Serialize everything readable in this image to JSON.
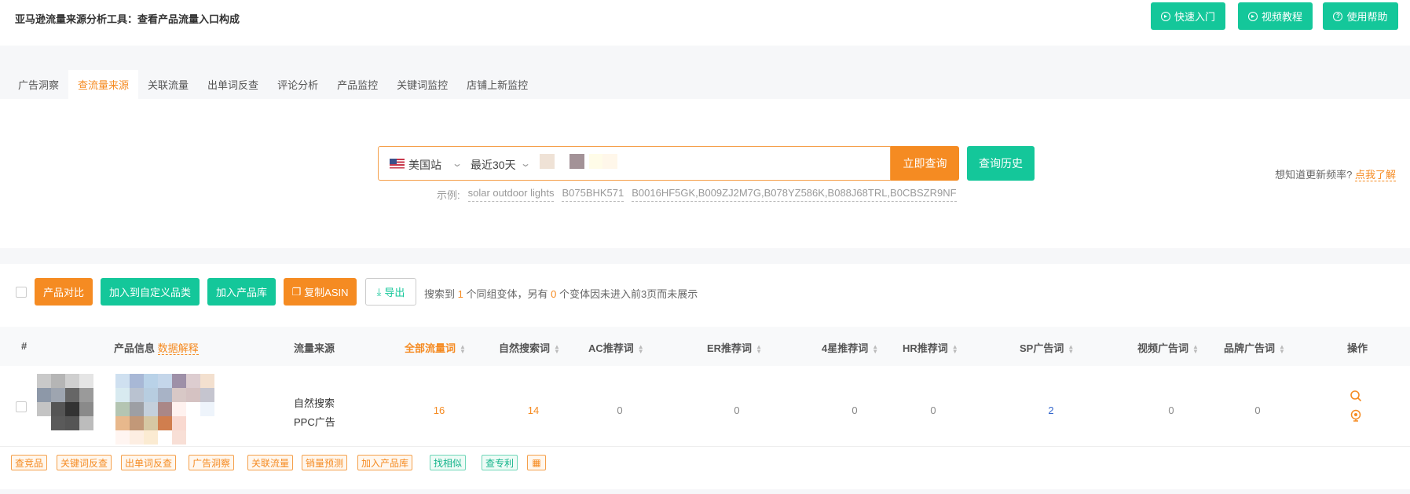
{
  "header": {
    "title": "亚马逊流量来源分析工具：查看产品流量入口构成",
    "buttons": [
      "快速入门",
      "视频教程",
      "使用帮助"
    ]
  },
  "tabs": [
    "广告洞察",
    "查流量来源",
    "关联流量",
    "出单词反查",
    "评论分析",
    "产品监控",
    "关键词监控",
    "店铺上新监控"
  ],
  "active_tab": "查流量来源",
  "search": {
    "site": "美国站",
    "period": "最近30天",
    "query_button": "立即查询",
    "history_button": "查询历史",
    "examples_label": "示例:",
    "examples": [
      "solar outdoor lights",
      "B075BHK571",
      "B0016HF5GK,B009ZJ2M7G,B078YZ586K,B088J68TRL,B0CBSZR9NF"
    ],
    "update_hint": "想知道更新频率?",
    "update_link": "点我了解"
  },
  "toolbar": {
    "buttons": [
      "产品对比",
      "加入到自定义品类",
      "加入产品库",
      "复制ASIN",
      "导出"
    ],
    "summary_pre": "搜索到",
    "summary_count1": "1",
    "summary_mid": "个同组变体，另有",
    "summary_count2": "0",
    "summary_post": "个变体因未进入前3页而未展示"
  },
  "table": {
    "headers": {
      "index": "#",
      "product": "产品信息",
      "product_link": "数据解释",
      "source": "流量来源",
      "all": "全部流量词",
      "organic": "自然搜索词",
      "ac": "AC推荐词",
      "er": "ER推荐词",
      "star4": "4星推荐词",
      "hr": "HR推荐词",
      "sp": "SP广告词",
      "video": "视频广告词",
      "brand": "品牌广告词",
      "ops": "操作"
    },
    "row": {
      "sources": [
        "自然搜索",
        "PPC广告"
      ],
      "all": "16",
      "organic": "14",
      "ac": "0",
      "er": "0",
      "star4": "0",
      "hr": "0",
      "sp": "2",
      "video": "0",
      "brand": "0"
    }
  },
  "row_tags": [
    "查竞品",
    "关键词反查",
    "出单词反查",
    "广告洞察",
    "关联流量",
    "销量预测",
    "加入产品库",
    "找相似",
    "查专利"
  ]
}
